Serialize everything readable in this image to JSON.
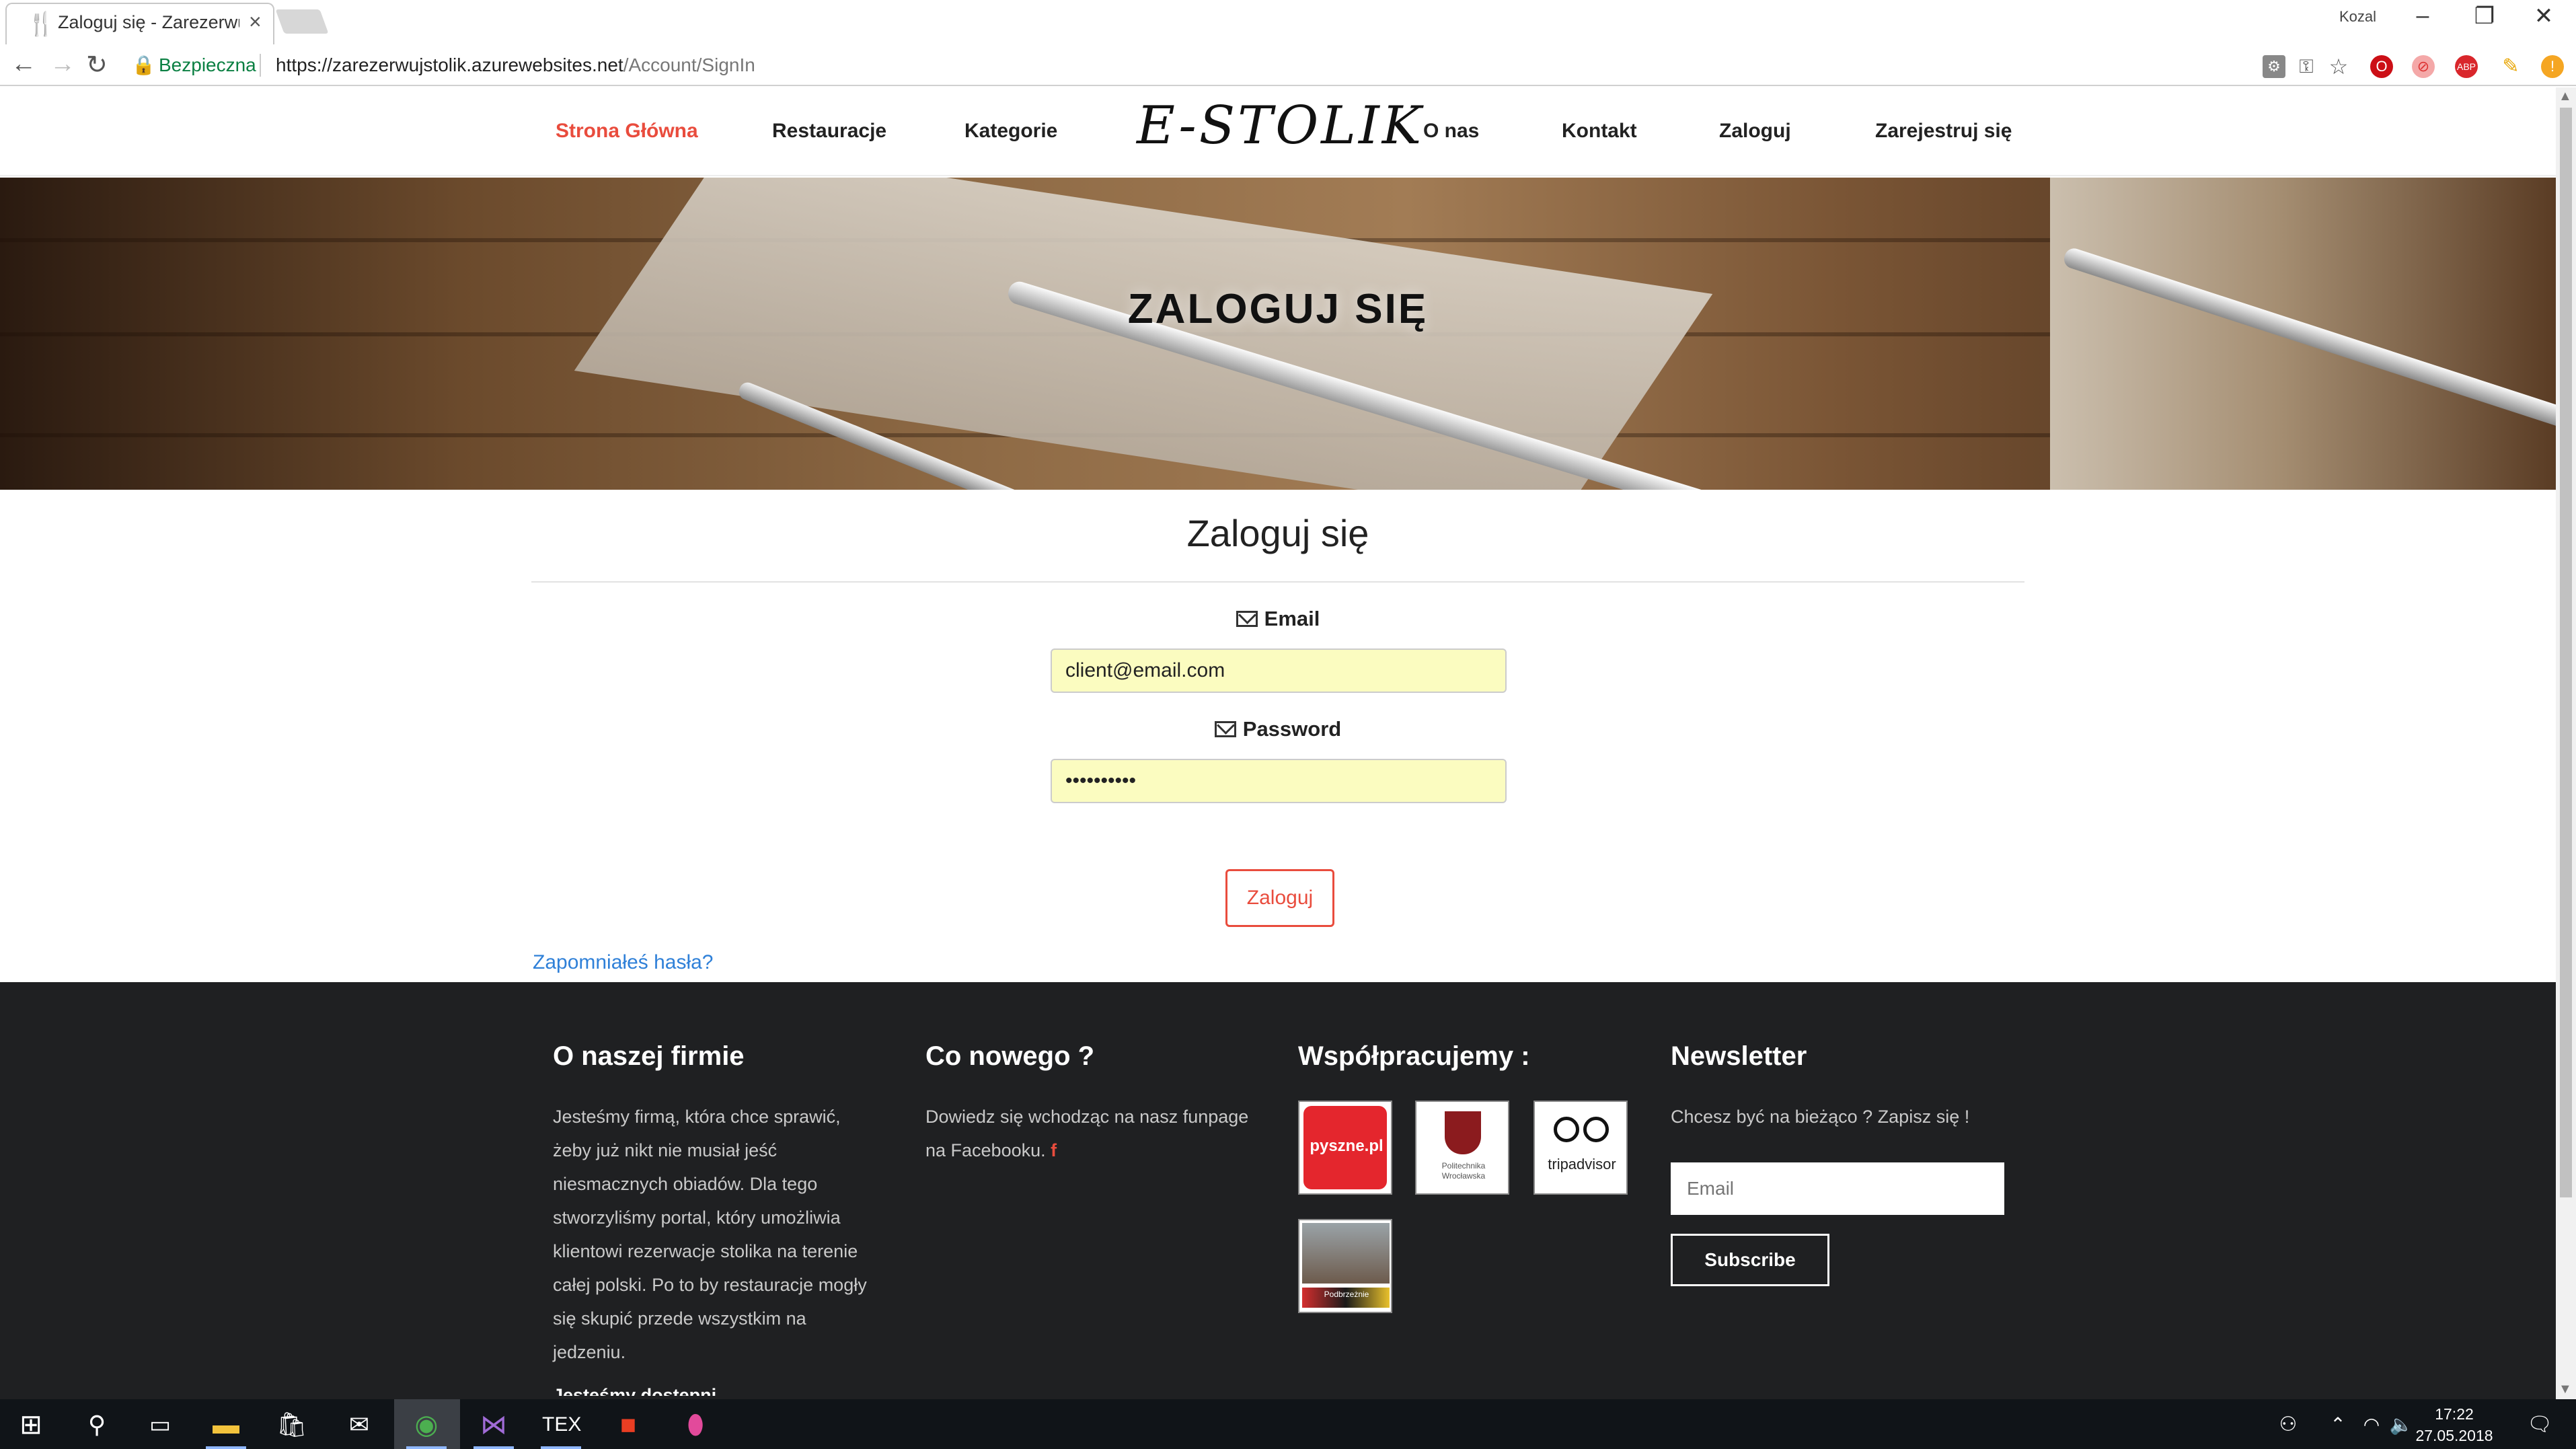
{
  "browser": {
    "tab_title": "Zaloguj się - Zarezerwuj S",
    "profile_name": "Kozal",
    "secure_label": "Bezpieczna",
    "url_host": "https://zarezerwujstolik.azurewebsites.net",
    "url_path": "/Account/SignIn"
  },
  "site": {
    "nav_left": [
      "Strona Główna",
      "Restauracje",
      "Kategorie"
    ],
    "logo": "E-STOLIK",
    "nav_right": [
      "O nas",
      "Kontakt",
      "Zaloguj",
      "Zarejestruj się"
    ],
    "accent_color": "#e94c3d"
  },
  "hero": {
    "title": "ZALOGUJ SIĘ"
  },
  "form": {
    "title": "Zaloguj się",
    "email_label": "Email",
    "email_value": "client@email.com",
    "password_label": "Password",
    "password_value": "••••••••••",
    "submit_label": "Zaloguj",
    "forgot_label": "Zapomniałeś hasła?"
  },
  "footer": {
    "about": {
      "title": "O naszej firmie",
      "text": "Jesteśmy firmą, która chce sprawić, żeby już nikt nie musiał jeść niesmacznych obiadów. Dla tego stworzyliśmy portal, który umożliwia klientowi rezerwacje stolika na terenie całej polski. Po to by restauracje mogły się skupić przede wszystkim na jedzeniu.",
      "cut_text": "Jesteśmy dostępni"
    },
    "news": {
      "title": "Co nowego ?",
      "text": "Dowiedz się wchodząc na nasz funpage na Facebooku.",
      "fb_icon": "f"
    },
    "partners": {
      "title": "Współpracujemy :",
      "logos": [
        "pyszne.pl",
        "Politechnika Wrocławska",
        "tripadvisor",
        "Podbrzeżnie"
      ]
    },
    "newsletter": {
      "title": "Newsletter",
      "text": "Chcesz być na bieżąco ? Zapisz się !",
      "email_placeholder": "Email",
      "button_label": "Subscribe"
    }
  },
  "taskbar": {
    "time": "17:22",
    "date": "27.05.2018"
  }
}
